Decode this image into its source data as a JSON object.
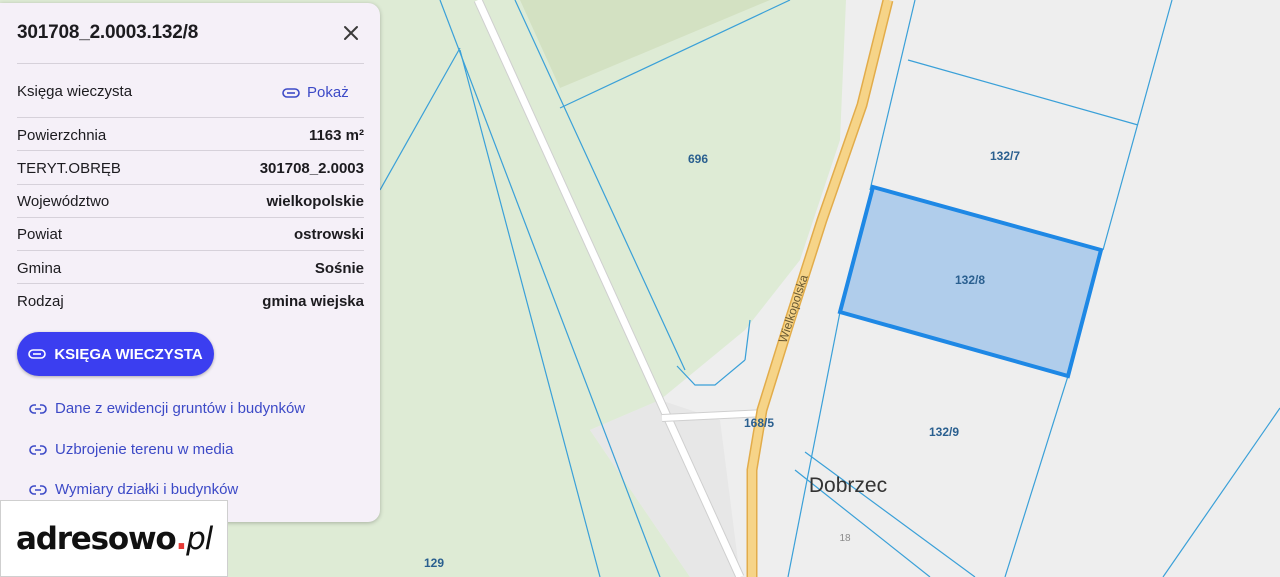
{
  "panel": {
    "title": "301708_2.0003.132/8",
    "land_register": {
      "label": "Księga wieczysta",
      "action": "Pokaż"
    },
    "rows": [
      {
        "label": "Powierzchnia",
        "value": "1163 m²"
      },
      {
        "label": "TERYT.OBRĘB",
        "value": "301708_2.0003"
      },
      {
        "label": "Województwo",
        "value": "wielkopolskie"
      },
      {
        "label": "Powiat",
        "value": "ostrowski"
      },
      {
        "label": "Gmina",
        "value": "Sośnie"
      },
      {
        "label": "Rodzaj",
        "value": "gmina wiejska"
      }
    ],
    "primary_button": "KSIĘGA WIECZYSTA",
    "links": [
      "Dane z ewidencji gruntów i budynków",
      "Uzbrojenie terenu w media",
      "Wymiary działki i budynków"
    ]
  },
  "map": {
    "parcel_labels": [
      "696",
      "132/7",
      "132/8",
      "132/9",
      "168/5",
      "129",
      "18"
    ],
    "street_name": "Wielkopolska",
    "place_name": "Dobrzec",
    "colors": {
      "background": "#eeeeee",
      "green_area": "#deebd5",
      "field": "#d3e1c2",
      "parcel_border": "#3aa0d8",
      "selected_fill": "#a9c9ea",
      "selected_border": "#1e88e5",
      "main_road": "#f6d488",
      "main_road_edge": "#e2ac4a"
    }
  },
  "logo": {
    "name": "adresowo",
    "dot": ".",
    "tld": "pl"
  }
}
